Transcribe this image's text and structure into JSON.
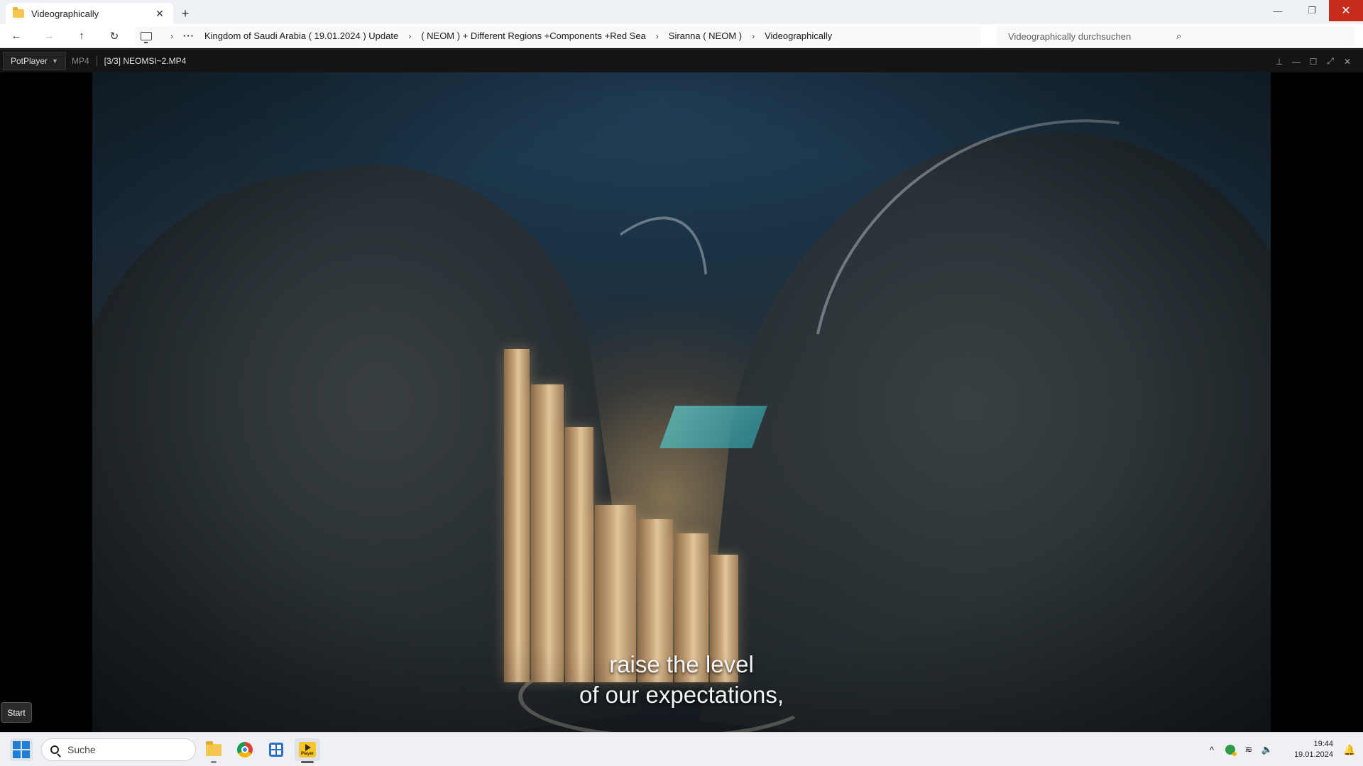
{
  "explorer": {
    "tab_title": "Videographically",
    "tab_close": "✕",
    "new_tab": "+",
    "window_controls": {
      "minimize": "—",
      "maximize": "❐",
      "close": "✕"
    },
    "nav": {
      "back": "←",
      "forward": "→",
      "up": "↑",
      "refresh": "↻",
      "more": "···"
    },
    "breadcrumb": [
      "Kingdom of Saudi Arabia ( 19.01.2024 ) Update",
      "( NEOM ) + Different Regions +Components +Red Sea",
      "Siranna ( NEOM )",
      "Videographically"
    ],
    "breadcrumb_sep": "›",
    "search_placeholder": "Videographically durchsuchen"
  },
  "player": {
    "brand": "PotPlayer",
    "format": "MP4",
    "file_title": "[3/3] NEOMSI~2.MP4",
    "controls": {
      "pin": "⊥",
      "minimize": "—",
      "maximize": "☐",
      "fullscreen": "⤢",
      "close": "✕"
    },
    "subtitle_lines": [
      "raise the level",
      "of our expectations,"
    ]
  },
  "tooltip": {
    "start": "Start"
  },
  "taskbar": {
    "search_placeholder": "Suche",
    "apps": [
      "file-explorer",
      "chrome",
      "microsoft-store",
      "potplayer"
    ],
    "potplayer_label": "Player",
    "tray": {
      "chevron": "^",
      "wifi": "≋",
      "volume": "🔈"
    },
    "clock": {
      "time": "19:44",
      "date": "19.01.2024"
    },
    "bell": "🔔"
  },
  "colors": {
    "explorer_bg": "#eef1f6",
    "close_red": "#c42b1c",
    "player_bg": "#141414",
    "taskbar_bg": "#eef0f3",
    "windows_blue": "#1f7fd6",
    "potplayer_yellow": "#f6c526"
  }
}
